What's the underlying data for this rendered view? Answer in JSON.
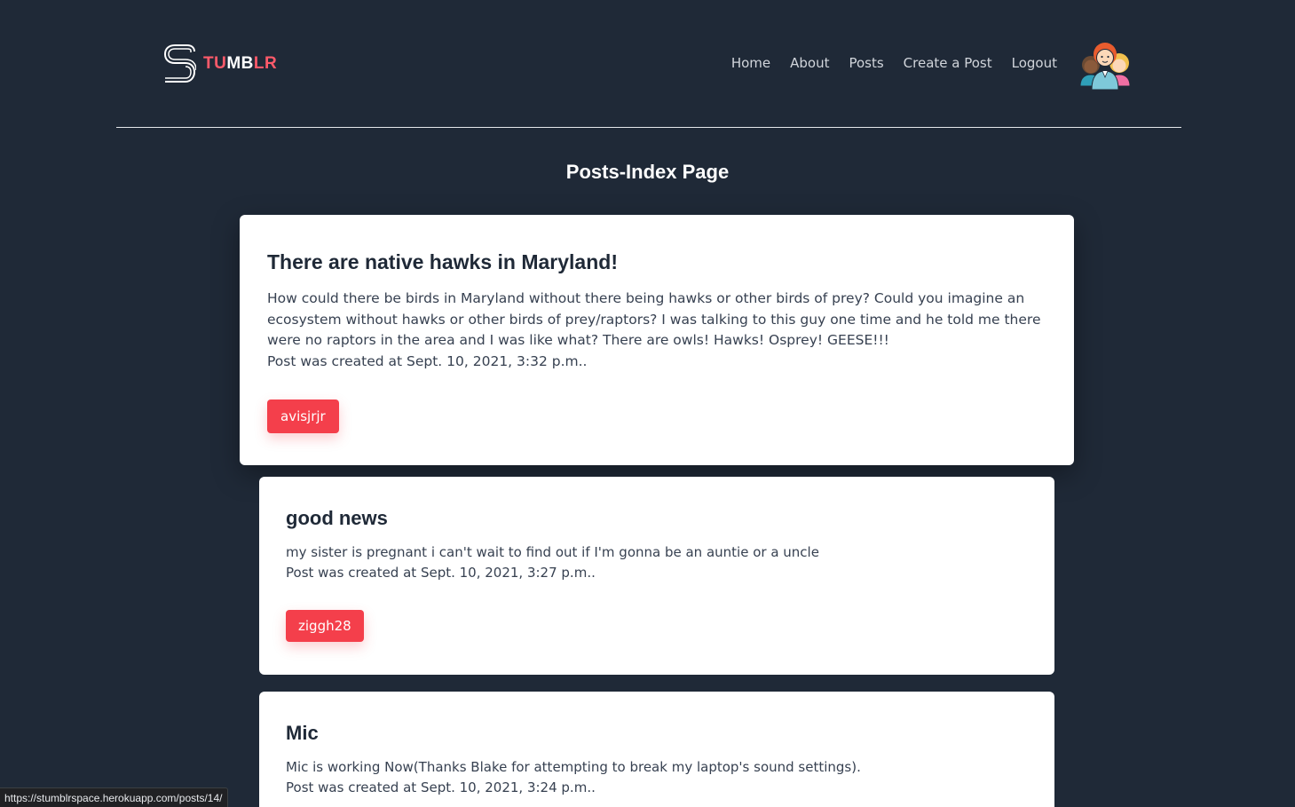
{
  "header": {
    "logo": {
      "part1": "TU",
      "part2": "MB",
      "part3": "LR"
    },
    "nav": [
      "Home",
      "About",
      "Posts",
      "Create a Post",
      "Logout"
    ]
  },
  "page_title": "Posts-Index Page",
  "posts": [
    {
      "title": "There are native hawks in Maryland!",
      "body": "How could there be birds in Maryland without there being hawks or other birds of prey? Could you imagine an ecosystem without hawks or other birds of prey/raptors? I was talking to this guy one time and he told me there were no raptors in the area and I was like what? There are owls! Hawks! Osprey! GEESE!!!",
      "created": "Post was created at Sept. 10, 2021, 3:32 p.m..",
      "author": "avisjrjr"
    },
    {
      "title": "good news",
      "body": "my sister is pregnant i can't wait to find out if I'm gonna be an auntie or a uncle",
      "created": "Post was created at Sept. 10, 2021, 3:27 p.m..",
      "author": "ziggh28"
    },
    {
      "title": "Mic",
      "body": "Mic is working Now(Thanks Blake for attempting to break my laptop's sound settings).",
      "created": "Post was created at Sept. 10, 2021, 3:24 p.m.."
    }
  ],
  "status_url": "https://stumblrspace.herokuapp.com/posts/14/",
  "colors": {
    "background": "#1f2937",
    "accent": "#f43f4b",
    "logo_accent": "#ff5a6a"
  }
}
